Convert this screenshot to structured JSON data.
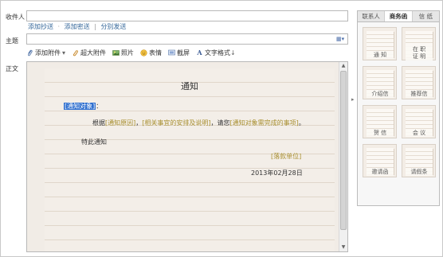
{
  "compose": {
    "recipients_label": "收件人",
    "recipients_value": "",
    "links": {
      "add_cc": "添加抄送",
      "dot": "·",
      "add_bcc": "添加密送",
      "sep": "|",
      "send_separately": "分别发送"
    },
    "subject_label": "主题",
    "subject_value": "",
    "body_label": "正文"
  },
  "toolbar": {
    "attach": "添加附件",
    "attach_arrow": "▾",
    "large_attach": "超大附件",
    "photo": "照片",
    "emoji": "表情",
    "screenshot": "截屏",
    "text_format": "文字格式",
    "text_format_arrow": "↓"
  },
  "document": {
    "title": "通知",
    "recipient_placeholder": "[通知对象]",
    "colon": "：",
    "line2_prefix": "根据",
    "reason_placeholder": "[通知原因]",
    "comma": "，",
    "arrangement_placeholder": "[相关事宜的安排及说明]",
    "line2_mid": "，请您",
    "matters_placeholder": "[通知对象需完成的事项]",
    "period": "。",
    "closing": "特此通知",
    "signature_placeholder": "[落款单位]",
    "date": "2013年02月28日"
  },
  "panel": {
    "tabs": [
      "联系人",
      "商务函",
      "信 纸"
    ],
    "active_tab": 1,
    "templates": [
      {
        "name": "通 知"
      },
      {
        "name": "在 职\n证 明"
      },
      {
        "name": "介绍信"
      },
      {
        "name": "推荐信"
      },
      {
        "name": "贺 信"
      },
      {
        "name": "会 议"
      },
      {
        "name": "邀请函"
      },
      {
        "name": "请假条"
      }
    ]
  },
  "icons": {
    "attach": "paperclip-icon",
    "large_attach": "large-paperclip-icon",
    "photo": "photo-icon",
    "emoji": "smiley-icon",
    "screenshot": "screenshot-icon",
    "text_format": "text-format-icon",
    "grid": "grid-icon",
    "collapse": "chevron-right-icon"
  },
  "colors": {
    "link": "#336699",
    "placeholder": "#a88f2f",
    "selection": "#2f6fcf",
    "paper": "#f3eee8"
  }
}
